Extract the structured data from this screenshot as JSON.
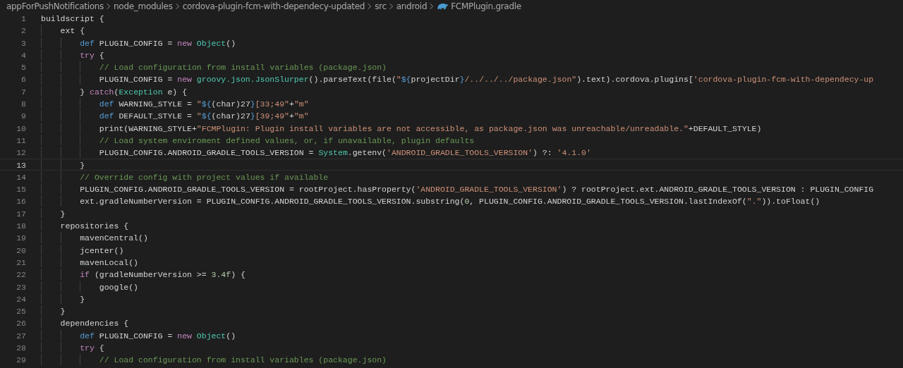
{
  "breadcrumb": [
    {
      "label": "appForPushNotifications",
      "kind": "folder"
    },
    {
      "label": "node_modules",
      "kind": "folder"
    },
    {
      "label": "cordova-plugin-fcm-with-dependecy-updated",
      "kind": "folder"
    },
    {
      "label": "src",
      "kind": "folder"
    },
    {
      "label": "android",
      "kind": "folder"
    },
    {
      "label": "FCMPlugin.gradle",
      "kind": "gradle-file"
    }
  ],
  "lines": [
    {
      "number": "1",
      "current": false,
      "tokens": [
        {
          "kind": "plain",
          "text": "buildscript {"
        }
      ]
    },
    {
      "number": "2",
      "current": false,
      "tokens": [
        {
          "kind": "plain",
          "text": "    ext {"
        }
      ]
    },
    {
      "number": "3",
      "current": false,
      "tokens": [
        {
          "kind": "keyword",
          "text": "        def"
        },
        {
          "kind": "plain",
          "text": " PLUGIN_CONFIG = "
        },
        {
          "kind": "control",
          "text": "new "
        },
        {
          "kind": "type",
          "text": "Object"
        },
        {
          "kind": "plain",
          "text": "()"
        }
      ]
    },
    {
      "number": "4",
      "current": false,
      "tokens": [
        {
          "kind": "control",
          "text": "        try"
        },
        {
          "kind": "plain",
          "text": " {"
        }
      ]
    },
    {
      "number": "5",
      "current": false,
      "tokens": [
        {
          "kind": "comment",
          "text": "            // Load configuration from install variables (package.json)"
        }
      ]
    },
    {
      "number": "6",
      "current": false,
      "tokens": [
        {
          "kind": "plain",
          "text": "            PLUGIN_CONFIG = "
        },
        {
          "kind": "control",
          "text": "new "
        },
        {
          "kind": "type",
          "text": "groovy.json.JsonSlurper"
        },
        {
          "kind": "plain",
          "text": "().parseText(file("
        },
        {
          "kind": "string",
          "text": "\""
        },
        {
          "kind": "keyword",
          "text": "${"
        },
        {
          "kind": "plain",
          "text": "projectDir"
        },
        {
          "kind": "keyword",
          "text": "}"
        },
        {
          "kind": "string",
          "text": "/../../../package.json\""
        },
        {
          "kind": "plain",
          "text": ").text).cordova.plugins["
        },
        {
          "kind": "string",
          "text": "'cordova-plugin-fcm-with-dependecy-up"
        }
      ]
    },
    {
      "number": "7",
      "current": false,
      "tokens": [
        {
          "kind": "plain",
          "text": "        } "
        },
        {
          "kind": "control",
          "text": "catch"
        },
        {
          "kind": "plain",
          "text": "("
        },
        {
          "kind": "type",
          "text": "Exception"
        },
        {
          "kind": "plain",
          "text": " e) {"
        }
      ]
    },
    {
      "number": "8",
      "current": false,
      "tokens": [
        {
          "kind": "keyword",
          "text": "            def"
        },
        {
          "kind": "plain",
          "text": " WARNING_STYLE = "
        },
        {
          "kind": "string",
          "text": "\""
        },
        {
          "kind": "keyword",
          "text": "${"
        },
        {
          "kind": "plain",
          "text": "(char)27"
        },
        {
          "kind": "keyword",
          "text": "}"
        },
        {
          "kind": "string",
          "text": "[33;49\""
        },
        {
          "kind": "plain",
          "text": "+"
        },
        {
          "kind": "string",
          "text": "\"m\""
        }
      ]
    },
    {
      "number": "9",
      "current": false,
      "tokens": [
        {
          "kind": "keyword",
          "text": "            def"
        },
        {
          "kind": "plain",
          "text": " DEFAULT_STYLE = "
        },
        {
          "kind": "string",
          "text": "\""
        },
        {
          "kind": "keyword",
          "text": "${"
        },
        {
          "kind": "plain",
          "text": "(char)27"
        },
        {
          "kind": "keyword",
          "text": "}"
        },
        {
          "kind": "string",
          "text": "[39;49\""
        },
        {
          "kind": "plain",
          "text": "+"
        },
        {
          "kind": "string",
          "text": "\"m\""
        }
      ]
    },
    {
      "number": "10",
      "current": false,
      "tokens": [
        {
          "kind": "plain",
          "text": "            print(WARNING_STYLE+"
        },
        {
          "kind": "string",
          "text": "\"FCMPlugin: Plugin install variables are not accessible, as package.json was unreachable/unreadable.\""
        },
        {
          "kind": "plain",
          "text": "+DEFAULT_STYLE)"
        }
      ]
    },
    {
      "number": "11",
      "current": false,
      "tokens": [
        {
          "kind": "comment",
          "text": "            // Load system enviroment defined values, or, if unavailable, plugin defaults"
        }
      ]
    },
    {
      "number": "12",
      "current": false,
      "tokens": [
        {
          "kind": "plain",
          "text": "            PLUGIN_CONFIG.ANDROID_GRADLE_TOOLS_VERSION = "
        },
        {
          "kind": "type",
          "text": "System"
        },
        {
          "kind": "plain",
          "text": ".getenv("
        },
        {
          "kind": "string",
          "text": "'ANDROID_GRADLE_TOOLS_VERSION'"
        },
        {
          "kind": "plain",
          "text": ") ?: "
        },
        {
          "kind": "string",
          "text": "'4.1.0'"
        }
      ]
    },
    {
      "number": "13",
      "current": true,
      "tokens": [
        {
          "kind": "plain",
          "text": "        }"
        }
      ]
    },
    {
      "number": "14",
      "current": false,
      "tokens": [
        {
          "kind": "comment",
          "text": "        // Override config with project values if available"
        }
      ]
    },
    {
      "number": "15",
      "current": false,
      "tokens": [
        {
          "kind": "plain",
          "text": "        PLUGIN_CONFIG.ANDROID_GRADLE_TOOLS_VERSION = rootProject.hasProperty("
        },
        {
          "kind": "string",
          "text": "'ANDROID_GRADLE_TOOLS_VERSION'"
        },
        {
          "kind": "plain",
          "text": ") ? rootProject.ext.ANDROID_GRADLE_TOOLS_VERSION : PLUGIN_CONFIG"
        }
      ]
    },
    {
      "number": "16",
      "current": false,
      "tokens": [
        {
          "kind": "plain",
          "text": "        ext.gradleNumberVersion = PLUGIN_CONFIG.ANDROID_GRADLE_TOOLS_VERSION.substring("
        },
        {
          "kind": "number",
          "text": "0"
        },
        {
          "kind": "plain",
          "text": ", PLUGIN_CONFIG.ANDROID_GRADLE_TOOLS_VERSION.lastIndexOf("
        },
        {
          "kind": "string",
          "text": "\".\""
        },
        {
          "kind": "plain",
          "text": ")).toFloat()"
        }
      ]
    },
    {
      "number": "17",
      "current": false,
      "tokens": [
        {
          "kind": "plain",
          "text": "    }"
        }
      ]
    },
    {
      "number": "18",
      "current": false,
      "tokens": [
        {
          "kind": "plain",
          "text": "    repositories {"
        }
      ]
    },
    {
      "number": "19",
      "current": false,
      "tokens": [
        {
          "kind": "plain",
          "text": "        mavenCentral()"
        }
      ]
    },
    {
      "number": "20",
      "current": false,
      "tokens": [
        {
          "kind": "plain",
          "text": "        jcenter()"
        }
      ]
    },
    {
      "number": "21",
      "current": false,
      "tokens": [
        {
          "kind": "plain",
          "text": "        mavenLocal()"
        }
      ]
    },
    {
      "number": "22",
      "current": false,
      "tokens": [
        {
          "kind": "control",
          "text": "        if"
        },
        {
          "kind": "plain",
          "text": " (gradleNumberVersion >= "
        },
        {
          "kind": "number",
          "text": "3.4f"
        },
        {
          "kind": "plain",
          "text": ") {"
        }
      ]
    },
    {
      "number": "23",
      "current": false,
      "tokens": [
        {
          "kind": "plain",
          "text": "            google()"
        }
      ]
    },
    {
      "number": "24",
      "current": false,
      "tokens": [
        {
          "kind": "plain",
          "text": "        }"
        }
      ]
    },
    {
      "number": "25",
      "current": false,
      "tokens": [
        {
          "kind": "plain",
          "text": "    }"
        }
      ]
    },
    {
      "number": "26",
      "current": false,
      "tokens": [
        {
          "kind": "plain",
          "text": "    dependencies {"
        }
      ]
    },
    {
      "number": "27",
      "current": false,
      "tokens": [
        {
          "kind": "keyword",
          "text": "        def"
        },
        {
          "kind": "plain",
          "text": " PLUGIN_CONFIG = "
        },
        {
          "kind": "control",
          "text": "new "
        },
        {
          "kind": "type",
          "text": "Object"
        },
        {
          "kind": "plain",
          "text": "()"
        }
      ]
    },
    {
      "number": "28",
      "current": false,
      "tokens": [
        {
          "kind": "control",
          "text": "        try"
        },
        {
          "kind": "plain",
          "text": " {"
        }
      ]
    },
    {
      "number": "29",
      "current": false,
      "tokens": [
        {
          "kind": "comment",
          "text": "            // Load configuration from install variables (package.json)"
        }
      ]
    }
  ]
}
